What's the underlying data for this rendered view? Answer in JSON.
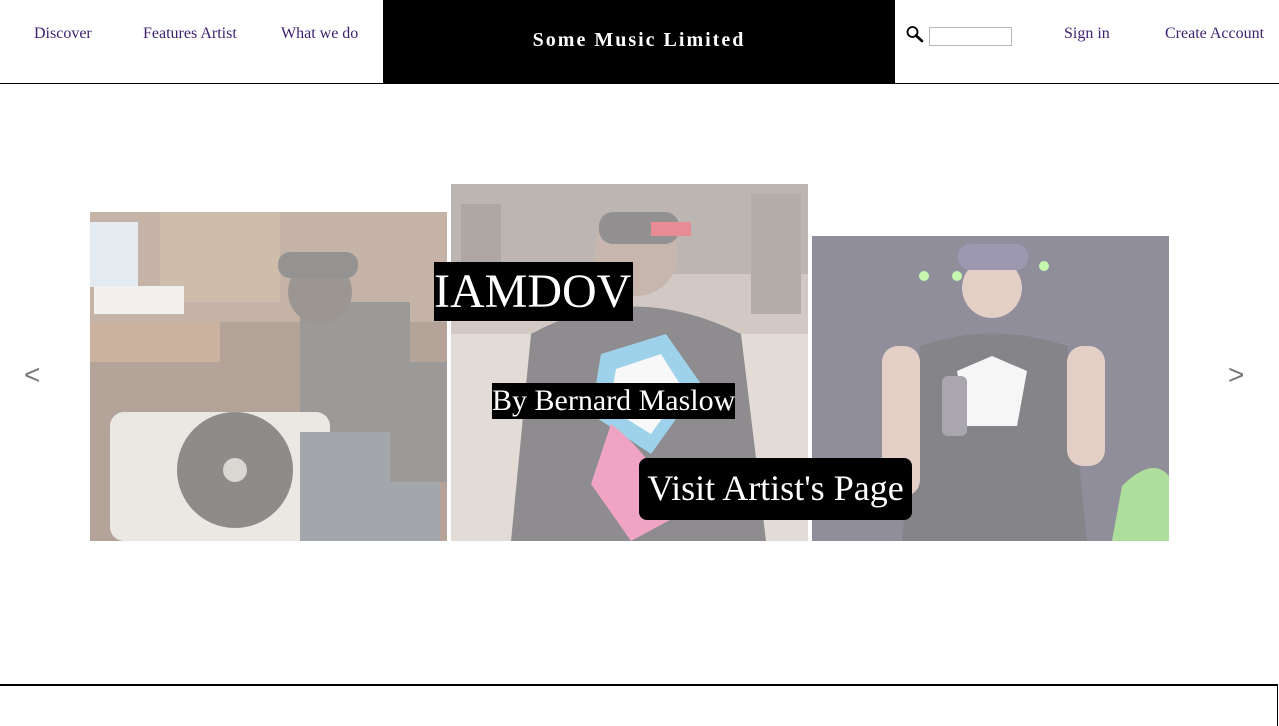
{
  "header": {
    "nav_left": [
      "Discover",
      "Features Artist",
      "What we do"
    ],
    "brand": "Some Music Limited",
    "search": {
      "icon": "search-icon",
      "value": "",
      "placeholder": ""
    },
    "nav_right": [
      "Sign in",
      "Create Account"
    ],
    "link_color": "#3d1f6e",
    "brand_bg": "#000000"
  },
  "carousel": {
    "prev_label": "<",
    "next_label": ">",
    "artist_name": "IAMDOV",
    "byline": "By Bernard Maslow",
    "cta_label": "Visit Artist's Page",
    "slides": [
      {
        "subject": "dj-at-turntable-photo"
      },
      {
        "subject": "artist-back-view-photo"
      },
      {
        "subject": "performer-on-stage-photo"
      }
    ]
  }
}
